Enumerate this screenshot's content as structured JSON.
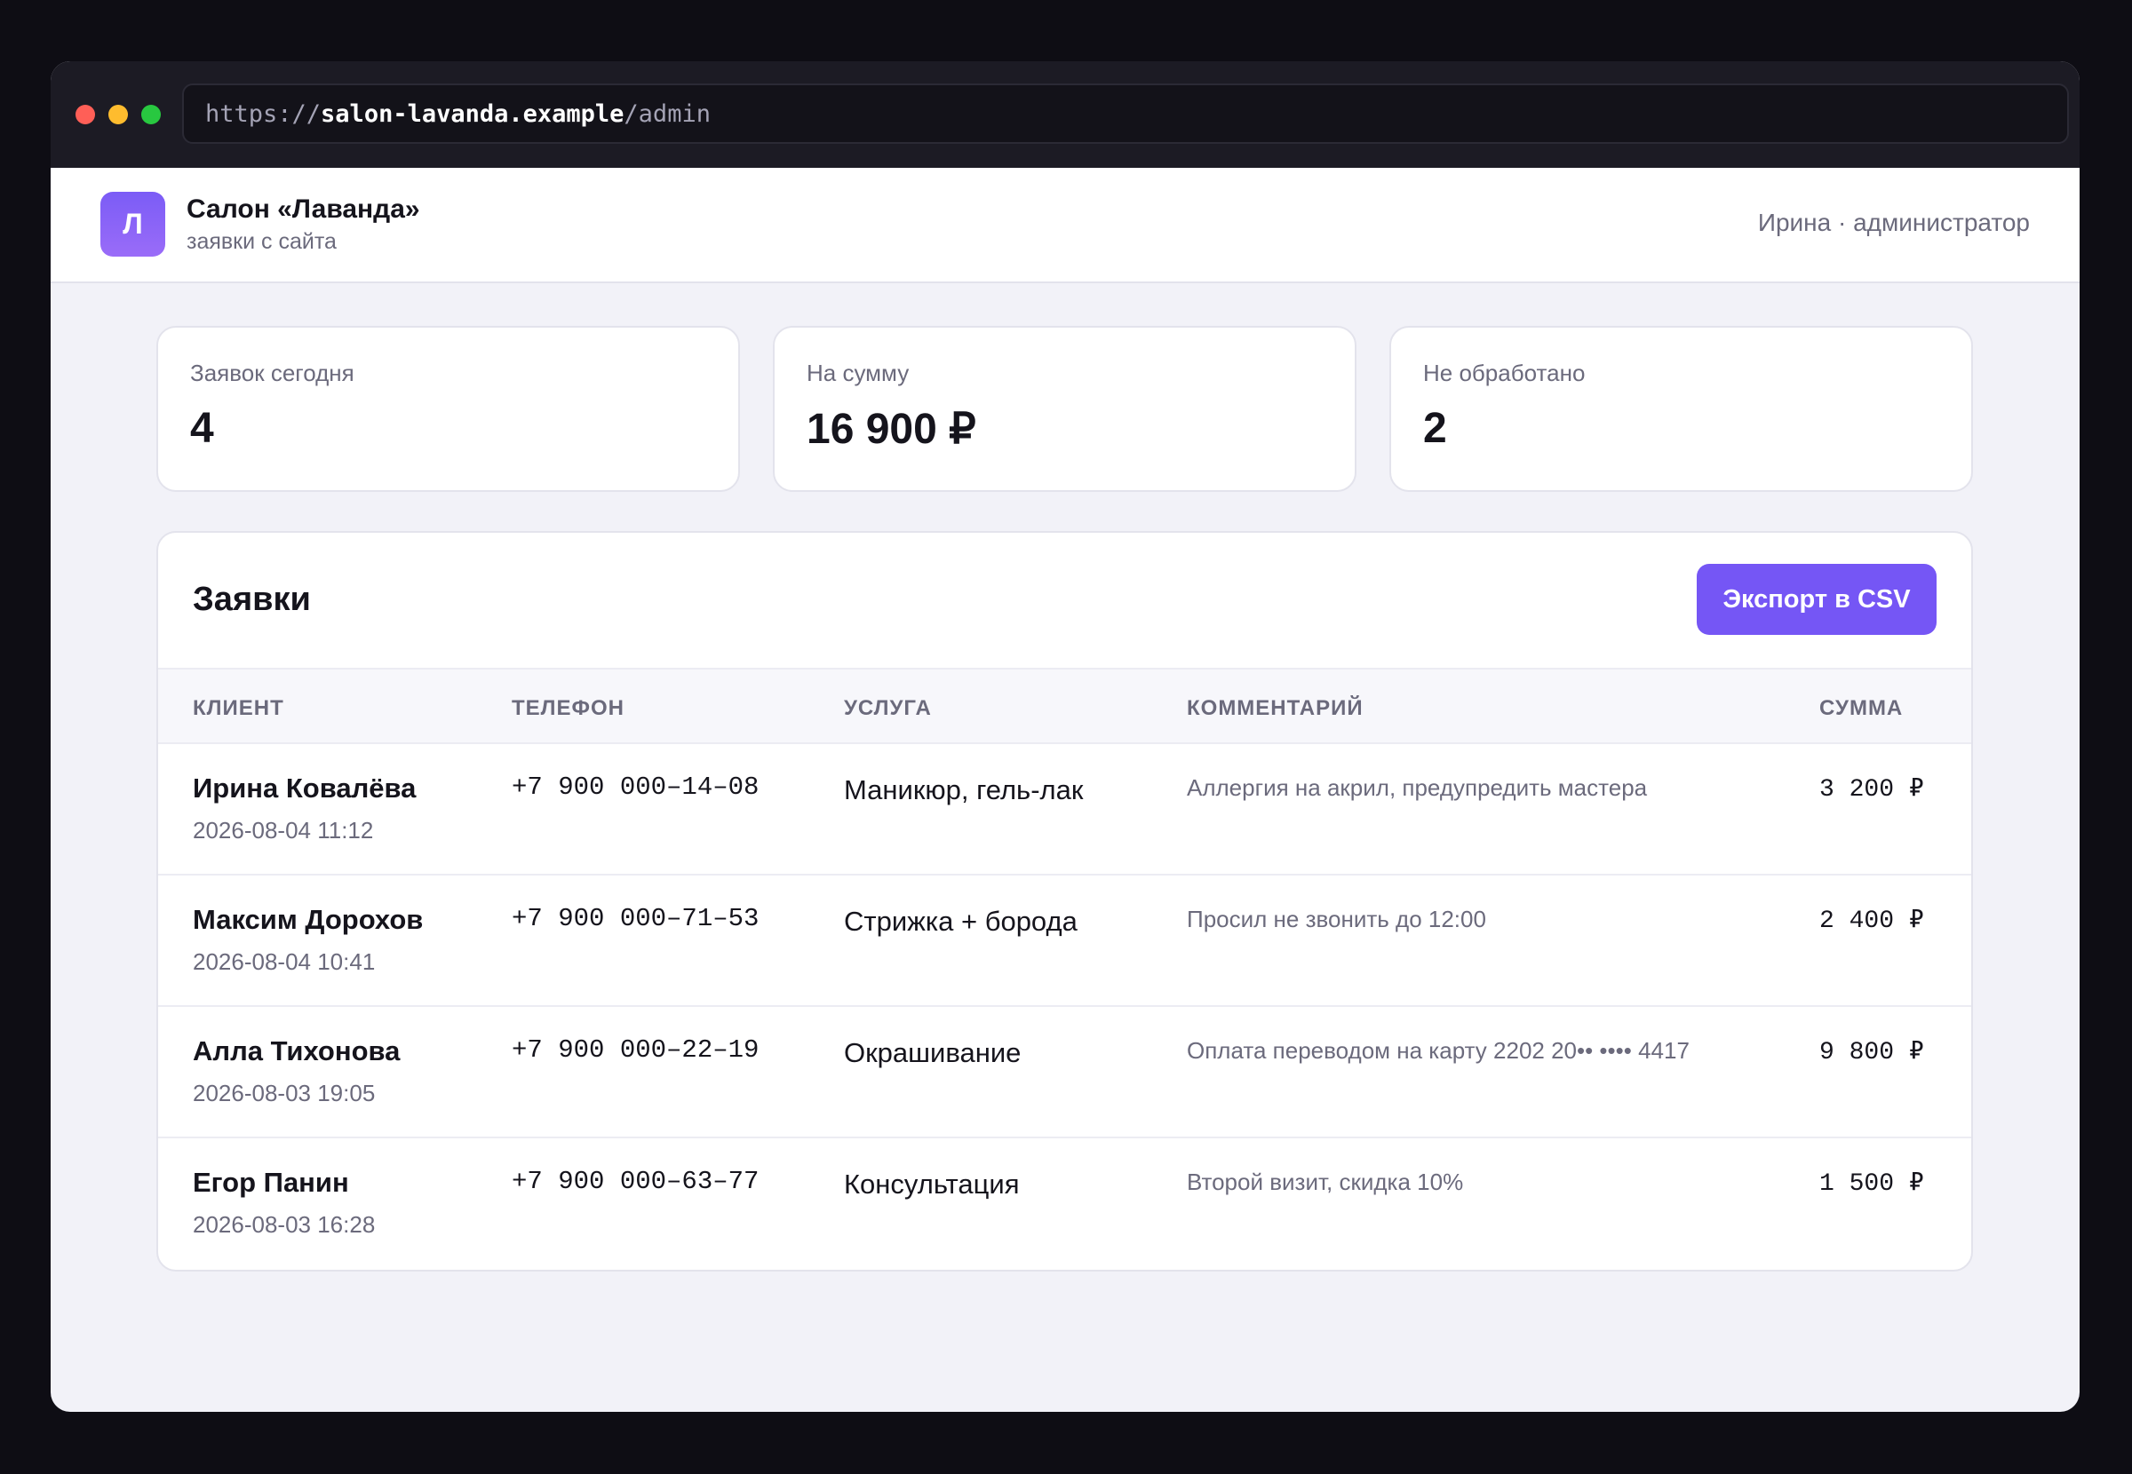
{
  "browser": {
    "url_prefix": "https://",
    "url_host": "salon-lavanda.example",
    "url_path": "/admin"
  },
  "header": {
    "logo_letter": "Л",
    "brand_name": "Салон «Лаванда»",
    "brand_subtitle": "заявки с сайта",
    "user": "Ирина · администратор"
  },
  "stats": [
    {
      "label": "Заявок сегодня",
      "value": "4"
    },
    {
      "label": "На сумму",
      "value": "16 900 ₽"
    },
    {
      "label": "Не обработано",
      "value": "2"
    }
  ],
  "orders": {
    "title": "Заявки",
    "export_label": "Экспорт в CSV",
    "columns": [
      "КЛИЕНТ",
      "ТЕЛЕФОН",
      "УСЛУГА",
      "КОММЕНТАРИЙ",
      "СУММА"
    ],
    "rows": [
      {
        "client": "Ирина Ковалёва",
        "datetime": "2026-08-04 11:12",
        "phone": "+7 900 000–14–08",
        "service": "Маникюр, гель-лак",
        "comment": "Аллергия на акрил, предупредить мастера",
        "sum": "3 200 ₽"
      },
      {
        "client": "Максим Дорохов",
        "datetime": "2026-08-04 10:41",
        "phone": "+7 900 000–71–53",
        "service": "Стрижка + борода",
        "comment": "Просил не звонить до 12:00",
        "sum": "2 400 ₽"
      },
      {
        "client": "Алла Тихонова",
        "datetime": "2026-08-03 19:05",
        "phone": "+7 900 000–22–19",
        "service": "Окрашивание",
        "comment": "Оплата переводом на карту 2202 20•• •••• 4417",
        "sum": "9 800 ₽"
      },
      {
        "client": "Егор Панин",
        "datetime": "2026-08-03 16:28",
        "phone": "+7 900 000–63–77",
        "service": "Консультация",
        "comment": "Второй визит, скидка 10%",
        "sum": "1 500 ₽"
      }
    ]
  },
  "colors": {
    "accent": "#7556f5",
    "page_bg": "#f2f2f8",
    "desktop_bg": "#0e0d14"
  }
}
